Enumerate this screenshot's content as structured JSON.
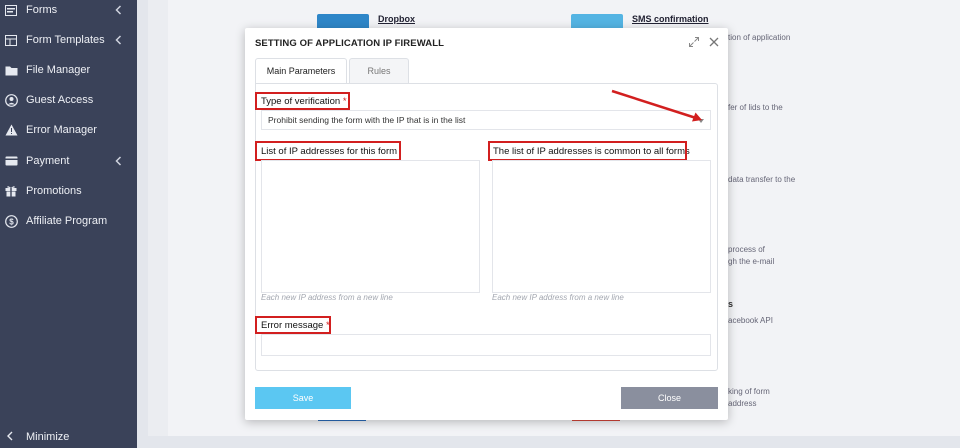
{
  "sidebar": {
    "items": [
      {
        "label": "Forms",
        "icon": "forms-icon",
        "chevron": true
      },
      {
        "label": "Form Templates",
        "icon": "templates-icon",
        "chevron": true
      },
      {
        "label": "File Manager",
        "icon": "folder-icon",
        "chevron": false
      },
      {
        "label": "Guest Access",
        "icon": "user-icon",
        "chevron": false
      },
      {
        "label": "Error Manager",
        "icon": "warning-icon",
        "chevron": false
      },
      {
        "label": "Payment",
        "icon": "payment-icon",
        "chevron": true
      },
      {
        "label": "Promotions",
        "icon": "gift-icon",
        "chevron": false
      },
      {
        "label": "Affiliate Program",
        "icon": "dollar-icon",
        "chevron": false
      }
    ],
    "minimize_label": "Minimize"
  },
  "background": {
    "card1_title": "Dropbox",
    "card2_title": "SMS confirmation",
    "snippets": [
      "tion of application",
      "fer of lids to the",
      "data transfer to the",
      "process of",
      "gh the e-mail",
      "s",
      "acebook API",
      "king of form",
      "address"
    ]
  },
  "modal": {
    "title": "SETTING OF APPLICATION IP FIREWALL",
    "tabs": [
      "Main Parameters",
      "Rules"
    ],
    "verification_label": "Type of verification",
    "required_mark": "*",
    "verification_value": "Prohibit sending the form with the IP that is in the list",
    "list_form_label": "List of IP addresses for this form",
    "list_common_label": "The list of IP addresses is common to all forms",
    "hint": "Each new IP address from a new line",
    "error_label": "Error message",
    "save_label": "Save",
    "close_label": "Close"
  },
  "colors": {
    "sidebar_bg": "#3a4259",
    "save_button": "#5bc7f2",
    "close_button": "#8a8f9e",
    "highlight": "#d21f1f",
    "arrow": "#d21f1f"
  }
}
